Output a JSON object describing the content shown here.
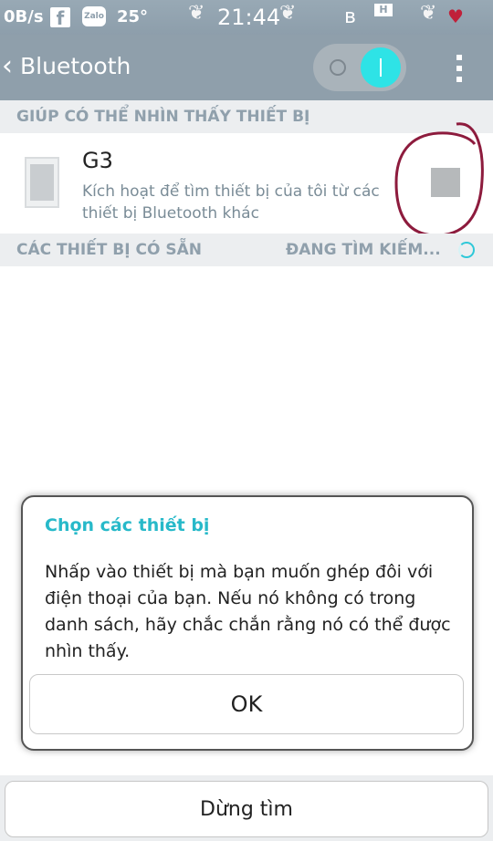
{
  "statusbar": {
    "net_speed": "0B/s",
    "facebook_glyph": "f",
    "zalo_label": "Zalo",
    "temperature": "25°",
    "time": "21:44",
    "h_indicator": "H",
    "icons": [
      "facebook-icon",
      "zalo-icon",
      "angel-wings-icon",
      "bluetooth-icon",
      "signal-icon",
      "winged-heart-icon"
    ]
  },
  "actionbar": {
    "title": "Bluetooth",
    "toggle_state": "on",
    "accent_color": "#2ee3e6"
  },
  "visibility_section": {
    "header": "GIÚP CÓ THỂ NHÌN THẤY THIẾT BỊ",
    "device_name": "G3",
    "device_desc": "Kích hoạt để tìm thiết bị của tôi từ các thiết bị Bluetooth khác",
    "checked": false
  },
  "available_section": {
    "header": "CÁC THIẾT  BỊ CÓ SẴN",
    "scanning_label": "ĐANG TÌM KIẾM..."
  },
  "dialog": {
    "title": "Chọn các thiết bị",
    "body": "Nhấp vào thiết bị mà bạn muốn ghép đôi với điện thoại của bạn. Nếu nó không có trong danh sách, hãy chắc chắn rằng nó có thể được nhìn thấy.",
    "ok_label": "OK",
    "title_color": "#27b9c9"
  },
  "bottom": {
    "stop_label": "Dừng tìm"
  }
}
